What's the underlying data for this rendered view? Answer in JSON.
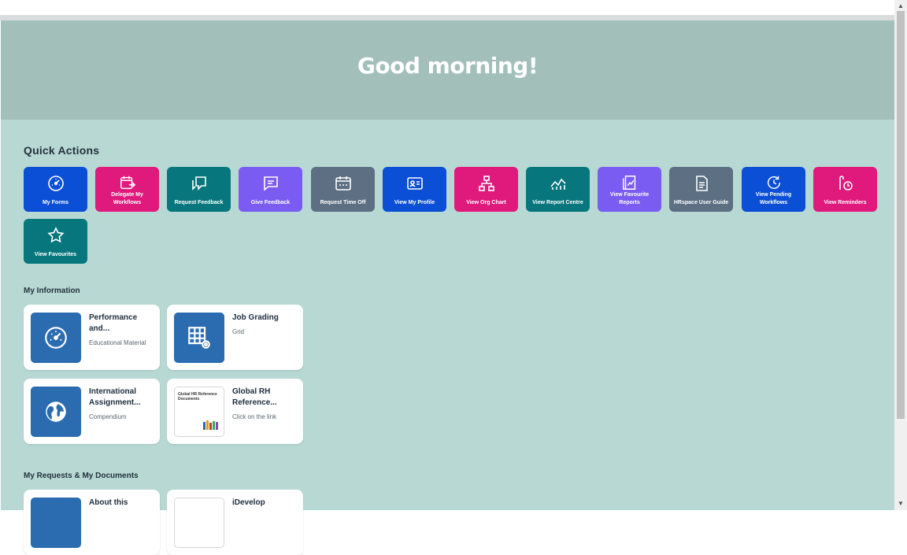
{
  "greeting": "Good morning!",
  "quick_actions": {
    "title": "Quick Actions",
    "tiles": [
      {
        "label": "My Forms",
        "icon": "gauge-icon",
        "color": "#0a4fd6"
      },
      {
        "label": "Delegate My Workflows",
        "icon": "calendar-forward-icon",
        "color": "#e0197d"
      },
      {
        "label": "Request Feedback",
        "icon": "feedback-request-icon",
        "color": "#08777d"
      },
      {
        "label": "Give Feedback",
        "icon": "feedback-icon",
        "color": "#7b5cf2"
      },
      {
        "label": "Request Time Off",
        "icon": "calendar-icon",
        "color": "#5c6f83"
      },
      {
        "label": "View My Profile",
        "icon": "id-card-icon",
        "color": "#0a4fd6"
      },
      {
        "label": "View Org Chart",
        "icon": "org-chart-icon",
        "color": "#e0197d"
      },
      {
        "label": "View Report Centre",
        "icon": "line-chart-icon",
        "color": "#08777d"
      },
      {
        "label": "View Favourite Reports",
        "icon": "report-icon",
        "color": "#7b5cf2"
      },
      {
        "label": "HRspace User Guide",
        "icon": "document-icon",
        "color": "#5c6f83"
      },
      {
        "label": "View Pending Workflows",
        "icon": "refresh-clock-icon",
        "color": "#0a4fd6"
      },
      {
        "label": "View Reminders",
        "icon": "reminder-icon",
        "color": "#e0197d"
      },
      {
        "label": "View Favourites",
        "icon": "star-icon",
        "color": "#08777d"
      }
    ]
  },
  "my_information": {
    "title": "My Information",
    "cards": [
      {
        "title": "Performance and...",
        "subtitle": "Educational Material",
        "icon": "gauge-icon"
      },
      {
        "title": "Job Grading",
        "subtitle": "Grid",
        "icon": "grid-settings-icon"
      },
      {
        "title": "International Assignment...",
        "subtitle": "Compendium",
        "icon": "globe-icon"
      },
      {
        "title": "Global RH Reference...",
        "subtitle": "Click on the link",
        "icon": "document-thumbnail",
        "thumb_text": "Global HR Reference Documents"
      }
    ]
  },
  "my_requests": {
    "title": "My Requests & My Documents",
    "cards": [
      {
        "title": "About this"
      },
      {
        "title": "iDevelop"
      }
    ]
  },
  "colors": {
    "hero": "#a2bfb9",
    "page": "#b8d9d3"
  }
}
